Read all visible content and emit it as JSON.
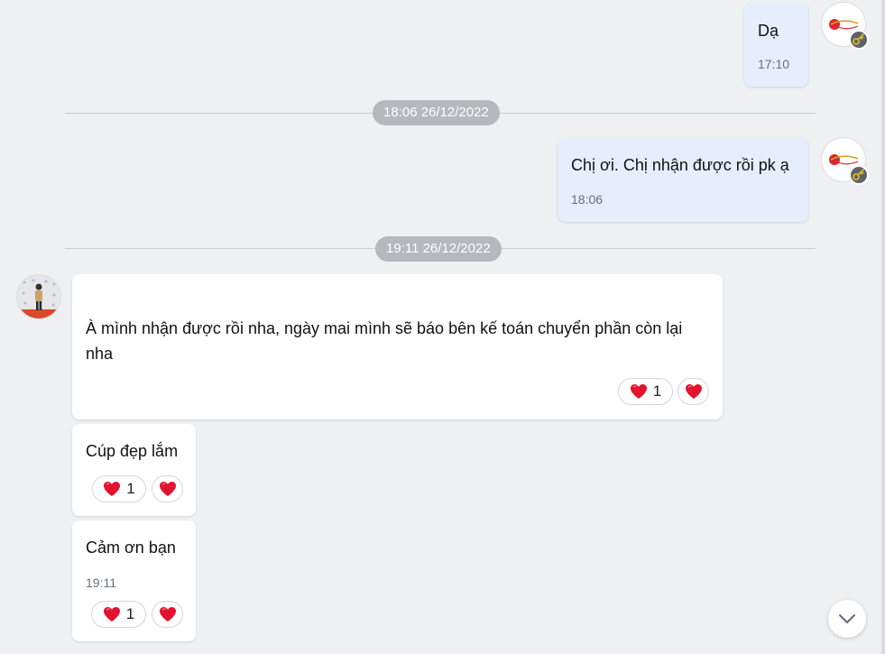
{
  "messages": [
    {
      "text": "Dạ",
      "time": "17:10",
      "sender": "me"
    },
    {
      "text": "Chị ơi. Chị nhận được rồi pk ạ",
      "time": "18:06",
      "sender": "me"
    },
    {
      "line1": "À mình nhận được rồi nha, ngày mai mình sẽ báo bên kế toán chuyển phần còn lại",
      "line2": "nha",
      "sender": "them",
      "reaction_count": "1"
    },
    {
      "text": "Cúp đẹp lắm",
      "sender": "them",
      "reaction_count": "1"
    },
    {
      "text": "Cảm ơn bạn",
      "time": "19:11",
      "sender": "them",
      "reaction_count": "1"
    }
  ],
  "dividers": [
    {
      "label": "18:06 26/12/2022"
    },
    {
      "label": "19:11 26/12/2022"
    }
  ],
  "colors": {
    "background": "#eef0f1",
    "my_bubble": "#e6eefd",
    "their_bubble": "#ffffff",
    "date_pill": "#b5b8bc",
    "heart": "#e3122e",
    "logo_red": "#d9262d",
    "logo_gold": "#c9a227"
  },
  "icons": {
    "my_avatar": "company-logo-avatar",
    "badge": "key-icon",
    "their_avatar": "person-photo-avatar",
    "reaction": "heart-icon",
    "scroll": "chevron-down-icon"
  }
}
